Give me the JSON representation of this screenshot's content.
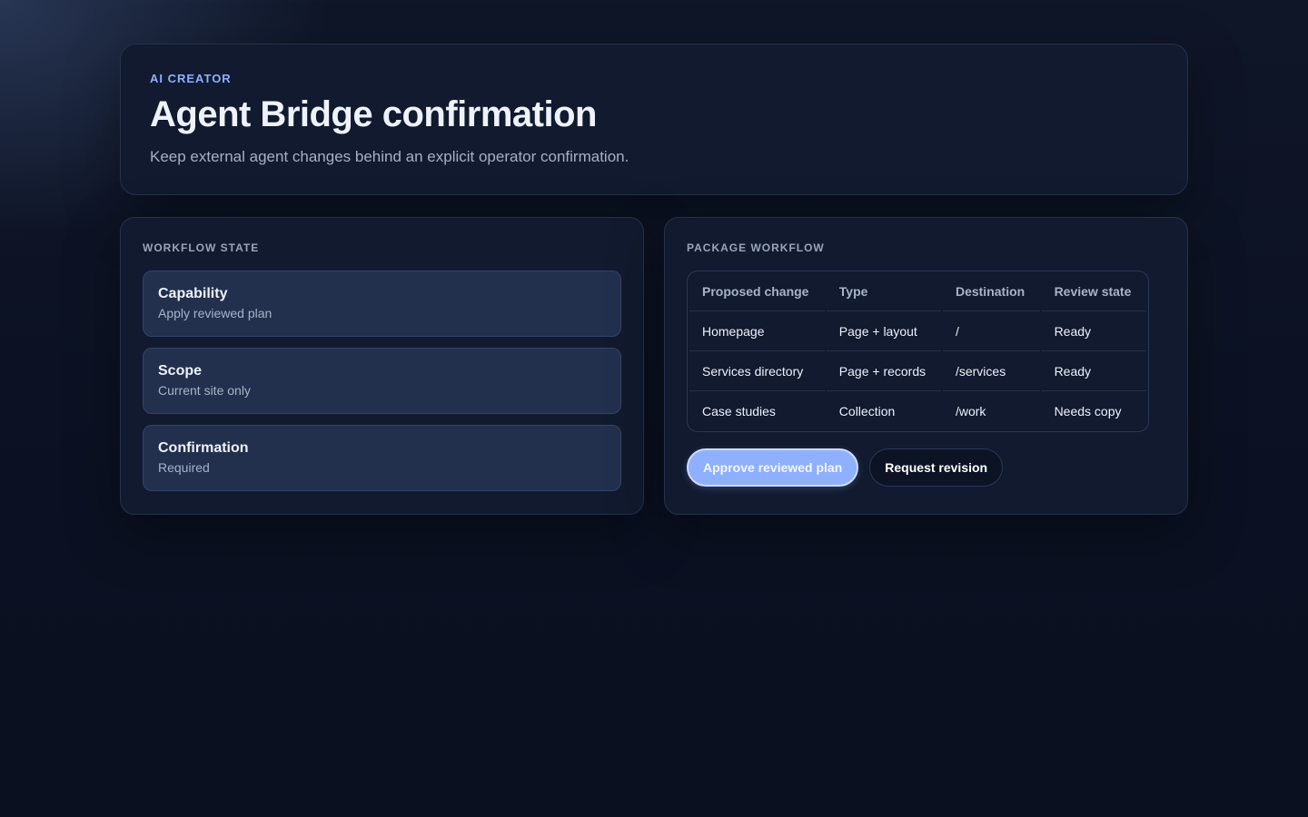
{
  "header": {
    "eyebrow": "AI CREATOR",
    "title": "Agent Bridge confirmation",
    "subtitle": "Keep external agent changes behind an explicit operator confirmation."
  },
  "workflow_state": {
    "title": "WORKFLOW STATE",
    "items": [
      {
        "name": "Capability",
        "value": "Apply reviewed plan"
      },
      {
        "name": "Scope",
        "value": "Current site only"
      },
      {
        "name": "Confirmation",
        "value": "Required"
      }
    ]
  },
  "package_workflow": {
    "title": "PACKAGE WORKFLOW",
    "columns": [
      "Proposed change",
      "Type",
      "Destination",
      "Review state"
    ],
    "rows": [
      [
        "Homepage",
        "Page + layout",
        "/",
        "Ready"
      ],
      [
        "Services directory",
        "Page + records",
        "/services",
        "Ready"
      ],
      [
        "Case studies",
        "Collection",
        "/work",
        "Needs copy"
      ]
    ],
    "actions": {
      "approve_label": "Approve reviewed plan",
      "revision_label": "Request revision"
    }
  },
  "colors": {
    "accent": "#8fb0ff",
    "background": "#0b1122",
    "card": "#111a2e",
    "state_card": "#22304d"
  }
}
